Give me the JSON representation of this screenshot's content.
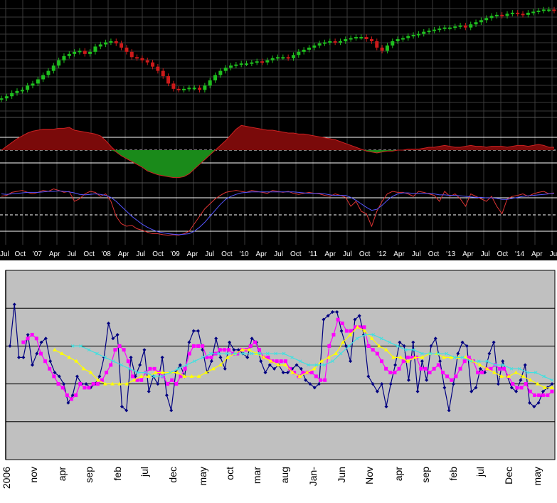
{
  "colors": {
    "top_background": "#000000",
    "grid": "#3a3a3a",
    "bull_candle": "#1fbf1f",
    "bear_candle": "#cc1a1a",
    "oscillator_line": "#cc2222",
    "oscillator_fill_positive": "#7a0a0a",
    "oscillator_fill_negative": "#1a8a1a",
    "stoch_fast": "#dd3333",
    "stoch_slow": "#5555ff",
    "reference_line": "#ffffff",
    "axis_text": "#ffffff",
    "bottom_plot_background": "#c0c0c0",
    "bottom_gridline": "#000000",
    "series_blue": "#000080",
    "series_magenta": "#ff00ff",
    "series_yellow": "#ffff00",
    "series_cyan": "#40e0e0"
  },
  "top_axis_labels": [
    "Jul",
    "Oct",
    "'07",
    "Apr",
    "Jul",
    "Oct",
    "'08",
    "Apr",
    "Jul",
    "Oct",
    "'09",
    "Apr",
    "Jul",
    "Oct",
    "'10",
    "Apr",
    "Jul",
    "Oct",
    "'11",
    "Apr",
    "Jul",
    "Oct",
    "'12",
    "Apr",
    "Jul",
    "Oct",
    "'13",
    "Apr",
    "Jul",
    "Oct",
    "'14",
    "Apr",
    "Jul"
  ],
  "bottom_axis_labels": [
    "2006",
    "nov",
    "apr",
    "sep",
    "feb",
    "jul",
    "dec",
    "may",
    "oct",
    "mar",
    "aug",
    "Jan-",
    "Jun",
    "Nov",
    "apr",
    "sep",
    "feb",
    "jul",
    "Dec",
    "may"
  ],
  "chart_data": [
    {
      "type": "candlestick",
      "panel": "price",
      "period": "monthly",
      "x_start": "2006-07",
      "x_end": "2014-07",
      "closes": [
        16,
        18,
        21,
        23,
        24,
        28,
        30,
        34,
        38,
        42,
        47,
        52,
        56,
        58,
        60,
        61,
        58,
        60,
        65,
        67,
        69,
        70,
        68,
        64,
        60,
        55,
        54,
        52,
        50,
        46,
        42,
        37,
        30,
        25,
        24,
        25,
        26,
        26,
        24,
        28,
        33,
        38,
        42,
        45,
        47,
        48,
        49,
        49,
        50,
        51,
        50,
        52,
        54,
        55,
        55,
        54,
        57,
        60,
        62,
        64,
        66,
        68,
        69,
        70,
        69,
        70,
        72,
        73,
        74,
        74,
        72,
        70,
        64,
        61,
        66,
        70,
        72,
        73,
        75,
        76,
        77,
        79,
        80,
        81,
        82,
        83,
        83,
        84,
        85,
        83,
        86,
        88,
        90,
        92,
        94,
        95,
        94,
        96,
        97,
        96,
        95,
        97,
        98,
        99,
        100,
        100,
        99
      ]
    },
    {
      "type": "area",
      "panel": "oscillator",
      "x_start": "2006-07",
      "x_end": "2014-07",
      "values": [
        0,
        4,
        8,
        12,
        15,
        18,
        20,
        21,
        22,
        22,
        22,
        23,
        23,
        24,
        21,
        20,
        19,
        18,
        17,
        15,
        10,
        4,
        -2,
        -6,
        -9,
        -12,
        -15,
        -18,
        -22,
        -24,
        -26,
        -27,
        -28,
        -29,
        -29,
        -28,
        -25,
        -20,
        -15,
        -10,
        -5,
        0,
        5,
        10,
        16,
        22,
        26,
        25,
        24,
        23,
        22,
        21,
        21,
        20,
        19,
        18,
        18,
        17,
        17,
        16,
        15,
        14,
        13,
        12,
        11,
        9,
        7,
        5,
        3,
        1,
        -1,
        -2,
        -3,
        -2,
        -1,
        -1,
        0,
        0,
        1,
        1,
        1,
        2,
        3,
        3,
        4,
        5,
        4,
        3,
        3,
        4,
        5,
        4,
        4,
        3,
        4,
        4,
        4,
        3,
        4,
        5,
        5,
        4,
        5,
        6,
        5,
        3,
        3
      ]
    },
    {
      "type": "line",
      "panel": "stochastic",
      "x_start": "2006-07",
      "x_end": "2014-07",
      "ylim": [
        0,
        100
      ],
      "series": [
        {
          "values": [
            80,
            82,
            88,
            90,
            92,
            88,
            85,
            88,
            92,
            90,
            95,
            92,
            88,
            90,
            70,
            75,
            85,
            90,
            88,
            80,
            85,
            70,
            40,
            25,
            20,
            22,
            15,
            12,
            8,
            5,
            5,
            3,
            2,
            3,
            2,
            5,
            10,
            25,
            40,
            55,
            65,
            75,
            82,
            88,
            90,
            92,
            90,
            88,
            92,
            90,
            88,
            86,
            92,
            90,
            88,
            90,
            86,
            84,
            86,
            88,
            86,
            85,
            82,
            80,
            85,
            82,
            78,
            60,
            70,
            50,
            45,
            20,
            50,
            70,
            85,
            90,
            88,
            88,
            85,
            80,
            90,
            88,
            85,
            82,
            70,
            90,
            80,
            85,
            75,
            60,
            85,
            80,
            75,
            70,
            80,
            60,
            45,
            75,
            80,
            82,
            85,
            80,
            85,
            88,
            90,
            85,
            87
          ]
        },
        {
          "values": [
            85,
            84,
            85,
            86,
            87,
            88,
            88,
            88,
            89,
            90,
            90,
            91,
            90,
            89,
            87,
            84,
            83,
            84,
            85,
            84,
            82,
            78,
            70,
            60,
            50,
            40,
            32,
            24,
            18,
            13,
            9,
            7,
            5,
            4,
            3,
            4,
            5,
            10,
            18,
            28,
            40,
            52,
            64,
            74,
            80,
            84,
            87,
            88,
            89,
            89,
            89,
            89,
            89,
            89,
            89,
            89,
            89,
            88,
            87,
            86,
            86,
            86,
            85,
            83,
            82,
            82,
            82,
            78,
            72,
            65,
            58,
            52,
            54,
            62,
            72,
            80,
            85,
            87,
            87,
            86,
            86,
            86,
            86,
            85,
            83,
            83,
            82,
            82,
            81,
            80,
            79,
            78,
            78,
            77,
            77,
            76,
            74,
            74,
            76,
            78,
            80,
            81,
            82,
            83,
            84,
            85,
            86
          ]
        }
      ]
    },
    {
      "type": "line",
      "panel": "bottom",
      "series": [
        {
          "name": "",
          "values": [
            3.0,
            4.1,
            2.7,
            2.7,
            3.3,
            2.5,
            2.8,
            3.1,
            3.2,
            2.6,
            2.3,
            2.2,
            2.0,
            1.5,
            1.7,
            2.2,
            2.0,
            2.0,
            1.9,
            2.0,
            2.2,
            2.7,
            3.6,
            3.2,
            3.3,
            1.4,
            1.3,
            2.7,
            2.2,
            2.5,
            2.9,
            1.8,
            2.2,
            2.0,
            2.7,
            1.7,
            1.3,
            2.3,
            2.5,
            2.2,
            3.1,
            3.4,
            3.4,
            2.9,
            2.3,
            2.6,
            3.2,
            2.7,
            2.4,
            3.1,
            2.9,
            2.9,
            2.8,
            2.7,
            3.2,
            3.1,
            2.6,
            2.3,
            2.5,
            2.4,
            2.5,
            2.3,
            2.3,
            2.4,
            2.5,
            2.4,
            2.1,
            2.0,
            1.9,
            2.0,
            3.7,
            3.8,
            3.9,
            3.9,
            3.4,
            3.0,
            2.6,
            3.7,
            3.8,
            3.3,
            2.2,
            2.0,
            1.8,
            2.0,
            1.4,
            2.0,
            2.5,
            3.1,
            3.0,
            2.1,
            3.1,
            1.8,
            2.6,
            2.1,
            3.0,
            3.2,
            2.6,
            1.9,
            1.3,
            2.0,
            2.8,
            3.1,
            3.0,
            1.8,
            1.9,
            2.4,
            2.3,
            2.8,
            3.1,
            2.0,
            2.6,
            2.2,
            1.9,
            1.8,
            2.1,
            2.5,
            1.5,
            1.4,
            1.5,
            1.8,
            1.9,
            2.0
          ]
        },
        {
          "name": "",
          "values": [
            3.1,
            3.2,
            3.3,
            3.2,
            2.8,
            2.6,
            2.4,
            2.2,
            2.0,
            1.9,
            1.7,
            1.6,
            1.7,
            2.0,
            1.9,
            1.9,
            2.0,
            2.0,
            2.1,
            2.3,
            2.5,
            2.9,
            3.0,
            2.9,
            2.6,
            2.2,
            2.1,
            2.1,
            2.3,
            2.4,
            2.4,
            2.3,
            2.2,
            2.0,
            2.1,
            2.0,
            2.2,
            2.4,
            2.8,
            3.0,
            3.0,
            3.0,
            2.7,
            2.7,
            2.8,
            2.9,
            2.9,
            2.9,
            2.8,
            2.8,
            2.9,
            2.9,
            3.0,
            3.1,
            2.9,
            2.7,
            2.7,
            2.6,
            2.6,
            2.6,
            2.6,
            2.4,
            2.3,
            2.2,
            2.3,
            2.3,
            2.3,
            2.2,
            2.1,
            2.1,
            3.0,
            3.3,
            3.7,
            3.6,
            3.4,
            3.4,
            3.5,
            3.5,
            3.5,
            3.0,
            2.9,
            2.8,
            2.6,
            2.4,
            2.3,
            2.3,
            2.4,
            2.6,
            2.7,
            2.7,
            2.7,
            2.4,
            2.4,
            2.3,
            2.4,
            2.5,
            2.3,
            2.2,
            2.1,
            2.2,
            2.4,
            2.6,
            2.7,
            2.6,
            2.3,
            2.3,
            2.4,
            2.4,
            2.5,
            2.4,
            2.4,
            2.2,
            2.0,
            1.9,
            1.9,
            2.0,
            1.8,
            1.7,
            1.7,
            1.7,
            1.7,
            1.8
          ]
        },
        {
          "name": "",
          "values": [
            2.9,
            2.8,
            2.7,
            2.6,
            2.4,
            2.3,
            2.1,
            2.0,
            2.0,
            2.0,
            2.0,
            2.1,
            2.2,
            2.2,
            2.3,
            2.3,
            2.3,
            2.3,
            2.2,
            2.2,
            2.2,
            2.3,
            2.4,
            2.5,
            2.7,
            2.8,
            2.9,
            2.9,
            2.8,
            2.7,
            2.6,
            2.5,
            2.5,
            2.3,
            2.2,
            2.3,
            2.4,
            2.6,
            2.7,
            2.8,
            3.1,
            3.3,
            3.5,
            3.4,
            3.2,
            3.0,
            2.9,
            2.7,
            2.7,
            2.6,
            2.7,
            2.7,
            2.8,
            2.8,
            2.7,
            2.7,
            2.7,
            2.7,
            2.6,
            2.5,
            2.4,
            2.3,
            2.2,
            2.2,
            2.3,
            2.2,
            2.1,
            2.0,
            1.9,
            1.9
          ]
        },
        {
          "name": "",
          "values": [
            3.0,
            3.0,
            2.9,
            2.8,
            2.7,
            2.6,
            2.5,
            2.4,
            2.3,
            2.3,
            2.2,
            2.2,
            2.3,
            2.4,
            2.5,
            2.6,
            2.7,
            2.8,
            2.8,
            2.8,
            2.8,
            2.8,
            2.8,
            2.8,
            2.8,
            2.8,
            2.8,
            2.7,
            2.6,
            2.5,
            2.5,
            2.5,
            2.6,
            2.8,
            3.0,
            3.2,
            3.3,
            3.3,
            3.2,
            3.1,
            3.0,
            2.9,
            2.9,
            2.8,
            2.8,
            2.8,
            2.8,
            2.7,
            2.7,
            2.6,
            2.6,
            2.6,
            2.5,
            2.5,
            2.4,
            2.4,
            2.3,
            2.3,
            2.2,
            2.1
          ]
        }
      ],
      "ylim": [
        0,
        5
      ],
      "gridlines": [
        1,
        2,
        3,
        4
      ]
    }
  ]
}
